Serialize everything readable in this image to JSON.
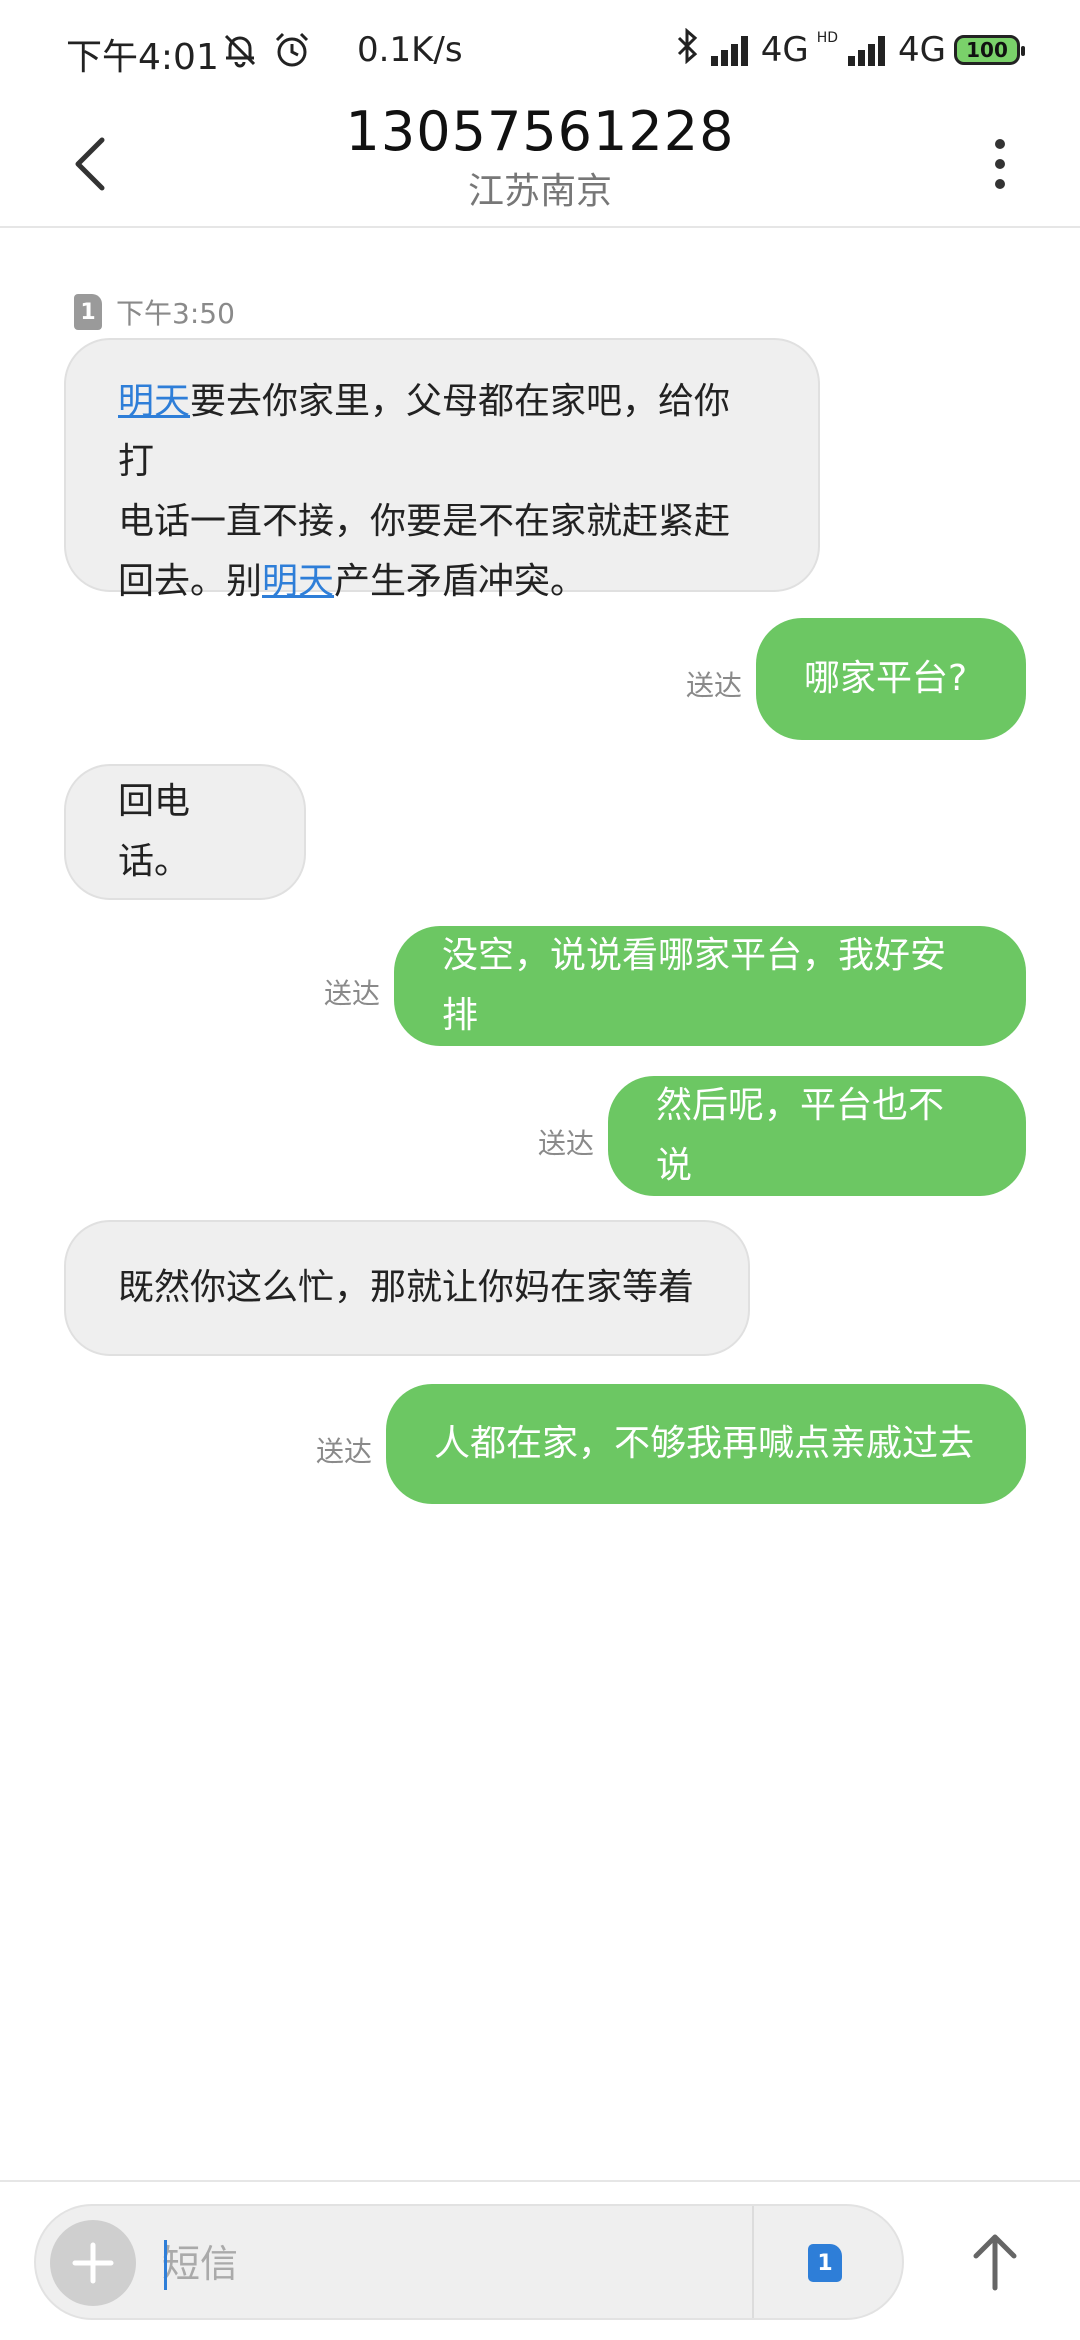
{
  "status_bar": {
    "time": "下午4:01",
    "net_speed": "0.1K/s",
    "network1": "4G",
    "network2": "4G",
    "hd": "HD",
    "battery": "100",
    "icons": [
      "mute-bell-icon",
      "alarm-icon",
      "bluetooth-icon",
      "signal-icon",
      "signal-icon",
      "battery-icon"
    ]
  },
  "header": {
    "title": "13057561228",
    "subtitle": "江苏南京",
    "back_icon": "back-arrow-icon",
    "menu_icon": "more-vertical-icon"
  },
  "conversation": {
    "sim_label": "1",
    "timestamp": "下午3:50",
    "msg1": {
      "line1_link": "明天",
      "line1_rest": "要去你家里，父母都在家吧，给你打",
      "line2": "电话一直不接，你要是不在家就赶紧赶",
      "line3_prefix": "回去。别",
      "line3_link": "明天",
      "line3_rest": "产生矛盾冲突。"
    },
    "msg2": {
      "text": "哪家平台?",
      "status": "送达"
    },
    "msg3": {
      "text": "回电话。"
    },
    "msg4": {
      "text": "没空，说说看哪家平台，我好安排",
      "status": "送达"
    },
    "msg5": {
      "text": "然后呢，平台也不说",
      "status": "送达"
    },
    "msg6": {
      "text": "既然你这么忙，那就让你妈在家等着"
    },
    "msg7": {
      "text": "人都在家，不够我再喊点亲戚过去",
      "status": "送达"
    }
  },
  "composer": {
    "placeholder": "短信",
    "sim_label": "1",
    "add_icon": "plus-icon",
    "send_icon": "send-arrow-icon"
  },
  "colors": {
    "outgoing_bubble": "#6cc763",
    "incoming_bubble": "#efefef",
    "link": "#2e7ed8"
  }
}
